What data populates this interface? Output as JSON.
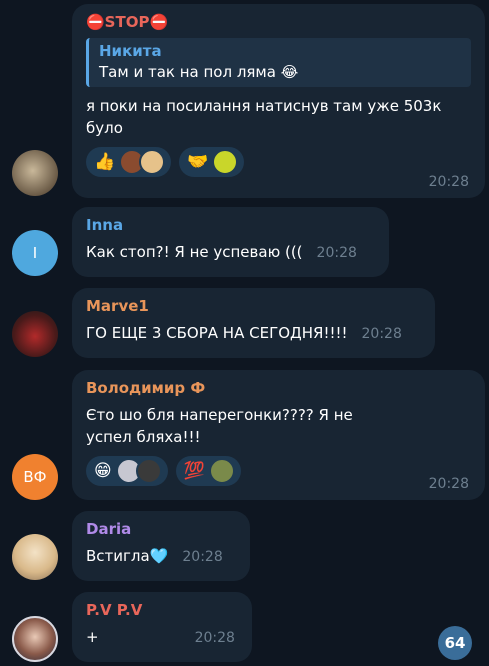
{
  "messages": [
    {
      "sender": "⛔STOP⛔",
      "reply": {
        "name": "Никита",
        "text": "Там и так на пол ляма 😂"
      },
      "text": "я поки на посилання натиснув там уже 503к було",
      "time": "20:28",
      "reactions": [
        {
          "emoji": "👍",
          "avatars": [
            "#8a4b2f",
            "#e6c28a"
          ]
        },
        {
          "emoji": "🤝",
          "avatars": [
            "#c9d62a"
          ]
        }
      ]
    },
    {
      "sender": "Inna",
      "avatar_initial": "I",
      "text": "Как стоп?!  Я не успеваю (((",
      "time": "20:28"
    },
    {
      "sender": "Marve1",
      "text": "ГО ЕЩЕ 3 СБОРА НА СЕГОДНЯ!!!!",
      "time": "20:28"
    },
    {
      "sender": "Володимир Ф",
      "avatar_initial": "ВФ",
      "text": "Єто шо бля наперегонки???? Я не успел бляха!!!",
      "time": "20:28",
      "reactions": [
        {
          "emoji": "😁",
          "avatars": [
            "#c7c7d1",
            "#3a3a3a"
          ]
        },
        {
          "emoji": "💯",
          "avatars": [
            "#7a8a4a"
          ]
        }
      ]
    },
    {
      "sender": "Daria",
      "text": "Встигла🩵",
      "time": "20:28"
    },
    {
      "sender": "P.V P.V",
      "text": "+",
      "time": "20:28"
    }
  ],
  "unread_count": "64",
  "colors": {
    "background": "#0e1621",
    "bubble": "#182533",
    "stop": "#e8665a",
    "inna": "#5aa7e6",
    "marve1": "#e8955a",
    "volodymyr": "#e8955a",
    "daria": "#b08ae8",
    "pv": "#e8665a",
    "avatar_inna": "#4fa8de",
    "avatar_vf": "#f0812f"
  }
}
